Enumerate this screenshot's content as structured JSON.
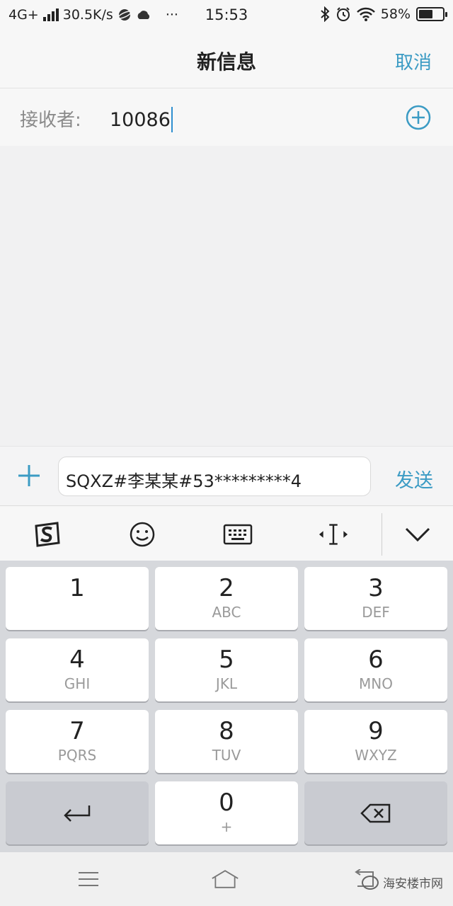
{
  "status_bar": {
    "network": "4G+",
    "speed": "30.5K/s",
    "more": "···",
    "time": "15:53",
    "battery_text": "58%",
    "battery_level": 0.58
  },
  "header": {
    "title": "新信息",
    "cancel_label": "取消"
  },
  "recipient": {
    "label": "接收者:",
    "value": "10086"
  },
  "compose": {
    "message": "SQXZ#李某某#53*********4",
    "send_label": "发送"
  },
  "keypad": {
    "keys": [
      {
        "num": "1",
        "letters": ""
      },
      {
        "num": "2",
        "letters": "ABC"
      },
      {
        "num": "3",
        "letters": "DEF"
      },
      {
        "num": "4",
        "letters": "GHI"
      },
      {
        "num": "5",
        "letters": "JKL"
      },
      {
        "num": "6",
        "letters": "MNO"
      },
      {
        "num": "7",
        "letters": "PQRS"
      },
      {
        "num": "8",
        "letters": "TUV"
      },
      {
        "num": "9",
        "letters": "WXYZ"
      },
      {
        "num": "0",
        "letters": "+"
      }
    ]
  },
  "watermark": {
    "text": "海安楼市网"
  },
  "icons": {
    "toolbar": [
      "sogou-logo-icon",
      "emoji-icon",
      "keyboard-icon",
      "cursor-move-icon",
      "collapse-keyboard-icon"
    ],
    "keys": [
      "enter-icon",
      "backspace-icon"
    ],
    "nav": [
      "menu-icon",
      "home-icon",
      "back-icon"
    ]
  },
  "colors": {
    "accent": "#3b9bc4",
    "caret": "#2f8fd0"
  }
}
